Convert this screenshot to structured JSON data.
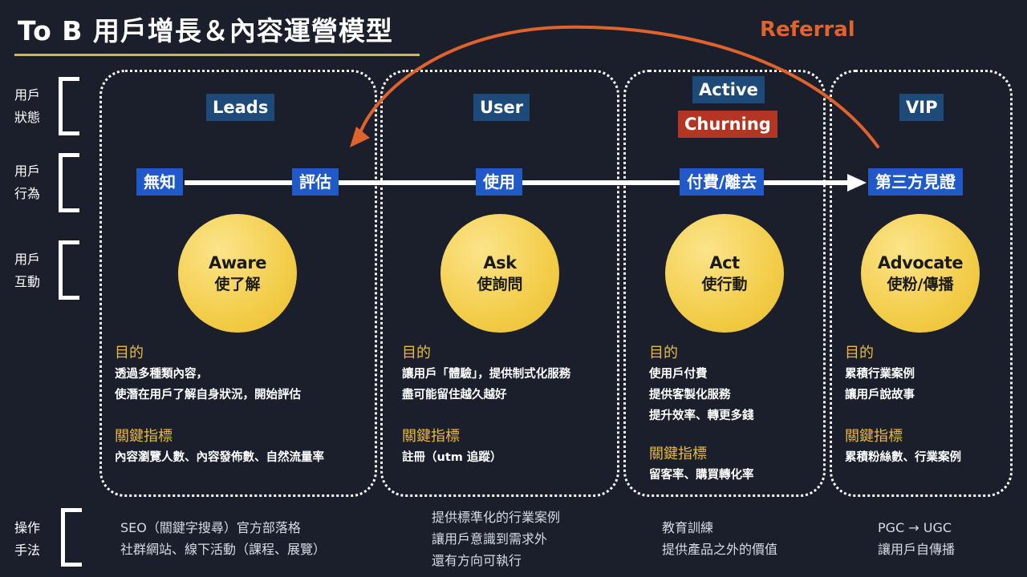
{
  "title": "To B 用戶增長＆內容運營模型",
  "referral_label": "Referral",
  "colors": {
    "background": "#1b1f2b",
    "accent_gold": "#e6b94a",
    "state_tag_blue": "#1e4a7a",
    "state_tag_red": "#b23621",
    "action_tag_blue": "#1f5ac8",
    "referral_orange": "#e0622c",
    "circle_yellow": "#f3cd4a"
  },
  "row_labels": [
    {
      "line1": "用戶",
      "line2": "狀態"
    },
    {
      "line1": "用戶",
      "line2": "行為"
    },
    {
      "line1": "用戶",
      "line2": "互動"
    },
    {
      "line1": "操作",
      "line2": "手法"
    }
  ],
  "columns": [
    {
      "states": [
        "Leads"
      ],
      "actions": [
        "無知",
        "評估"
      ],
      "circle": {
        "en": "Aware",
        "zh": "使了解"
      },
      "purpose_heading": "目的",
      "purpose": [
        "透過多種類內容，",
        "使潛在用戶了解自身狀況，開始評估"
      ],
      "kpi_heading": "關鍵指標",
      "kpi": [
        "內容瀏覽人數、內容發佈數、自然流量率"
      ],
      "operations": [
        "SEO（關鍵字搜尋）官方部落格",
        "社群網站、線下活動（課程、展覽）"
      ]
    },
    {
      "states": [
        "User"
      ],
      "actions": [
        "使用"
      ],
      "circle": {
        "en": "Ask",
        "zh": "使詢問"
      },
      "purpose_heading": "目的",
      "purpose": [
        "讓用戶「體驗」，提供制式化服務",
        "盡可能留住越久越好"
      ],
      "kpi_heading": "關鍵指標",
      "kpi": [
        "註冊（utm 追蹤）"
      ],
      "operations": [
        "提供標準化的行業案例",
        "讓用戶意識到需求外",
        "還有方向可執行"
      ]
    },
    {
      "states": [
        "Active",
        "Churning"
      ],
      "actions": [
        "付費/離去"
      ],
      "circle": {
        "en": "Act",
        "zh": "使行動"
      },
      "purpose_heading": "目的",
      "purpose": [
        "使用戶付費",
        "提供客製化服務",
        "提升效率、轉更多錢"
      ],
      "kpi_heading": "關鍵指標",
      "kpi": [
        "留客率、購買轉化率"
      ],
      "operations": [
        "教育訓練",
        "提供產品之外的價值"
      ]
    },
    {
      "states": [
        "VIP"
      ],
      "actions": [
        "第三方見證"
      ],
      "circle": {
        "en": "Advocate",
        "zh": "使粉/傳播"
      },
      "purpose_heading": "目的",
      "purpose": [
        "累積行業案例",
        "讓用戶說故事"
      ],
      "kpi_heading": "關鍵指標",
      "kpi": [
        "累積粉絲數、行業案例"
      ],
      "operations": [
        "PGC → UGC",
        "讓用戶自傳播"
      ]
    }
  ]
}
